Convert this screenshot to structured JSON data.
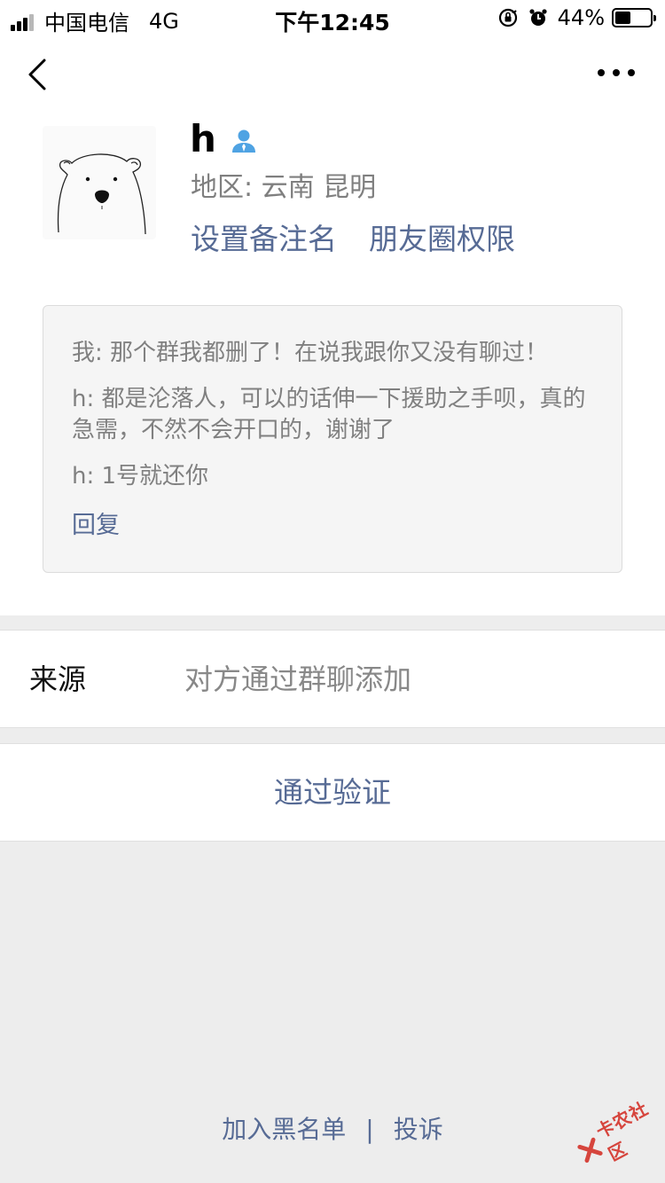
{
  "status_bar": {
    "carrier": "中国电信",
    "network": "4G",
    "time": "下午12:45",
    "battery": "44%",
    "battery_level": 0.44
  },
  "nav": {
    "back_icon": "chevron-left-icon",
    "more_icon": "more-horizontal-icon"
  },
  "profile": {
    "name": "h",
    "gender_icon": "user-male-icon",
    "region": "地区:  云南 昆明",
    "set_remark": "设置备注名",
    "moments_permission": "朋友圈权限"
  },
  "messages": {
    "items": [
      "我: 那个群我都删了！在说我跟你又没有聊过！",
      "h: 都是沦落人，可以的话伸一下援助之手呗，真的急需，不然不会开口的，谢谢了",
      "h: 1号就还你"
    ],
    "reply": "回复"
  },
  "source": {
    "label": "来源",
    "value": "对方通过群聊添加"
  },
  "verify": {
    "label": "通过验证"
  },
  "footer": {
    "blacklist": "加入黑名单",
    "separator": "|",
    "report": "投诉"
  },
  "watermark": {
    "text": "卡农社区"
  },
  "colors": {
    "link": "#576b95",
    "background": "#ededed",
    "secondary_text": "#808080",
    "watermark": "#d6453d"
  }
}
